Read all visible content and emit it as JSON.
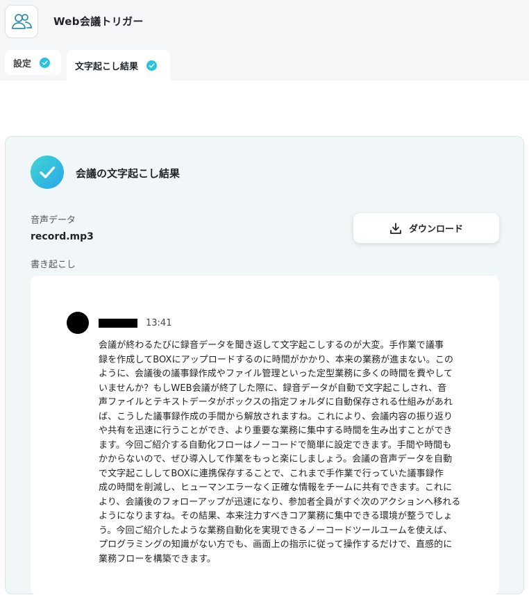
{
  "header": {
    "app_title": "Web会議トリガー",
    "app_icon": "users-icon"
  },
  "tabs": [
    {
      "label": "設定",
      "status": "completed"
    },
    {
      "label": "文字起こし結果",
      "status": "completed",
      "active": true
    }
  ],
  "result": {
    "title": "会議の文字起こし結果",
    "audio_label": "音声データ",
    "audio_file": "record.mp3",
    "download_label": "ダウンロード",
    "transcript_label": "書き起こし"
  },
  "transcript": {
    "time": "13:41",
    "text": "会議が終わるたびに録音データを聞き返して文字起こしするのが大変。手作業で議事\n録を作成してBOXにアップロードするのに時間がかかり、本来の業務が進まない。この\nように、会議後の議事録作成やファイル管理といった定型業務に多くの時間を費やして\nいませんか？もしWEB会議が終了した際に、録音データが自動で文字起こしされ、音\n声ファイルとテキストデータがボックスの指定フォルダに自動保存される仕組みがあれ\nば、こうした議事録作成の手間から解放されますね。これにより、会議内容の振り返り\nや共有を迅速に行うことができ、より重要な業務に集中する時間を生み出すことができ\nます。今回ご紹介する自動化フローはノーコードで簡単に設定できます。手間や時間も\nかからないので、ぜひ導入して作業をもっと楽にしましょう。会議の音声データを自動\nで文字起こししてBOXに連携保存することで、これまで手作業で行っていた議事録作\n成の時間を削減し、ヒューマンエラーなく正確な情報をチームに共有できます。これに\nより、会議後のフォローアップが迅速になり、参加者全員がすぐ次のアクションへ移れる\nようになりますね。その結果、本来注力すべきコア業務に集中できる環境が整うでしょ\nう。今回ご紹介したような業務自動化を実現できるノーコードツールユームを使えば、\nプログラミングの知識がない方でも、画面上の指示に従って操作するだけで、直感的に\n業務フローを構築できます。"
  },
  "colors": {
    "accent": "#28c2e0",
    "card_bg": "#f1f7f8",
    "topbar_bg": "#f5f6f7"
  }
}
